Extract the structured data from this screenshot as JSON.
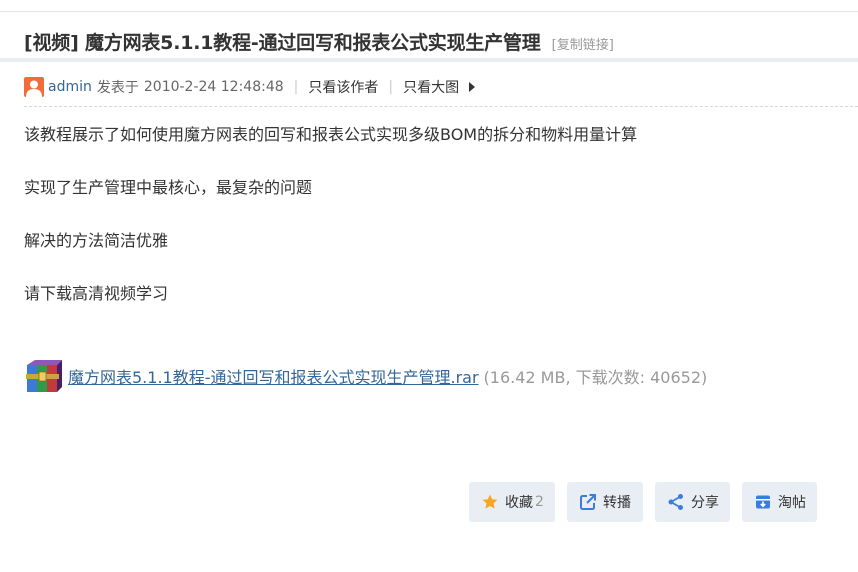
{
  "post": {
    "title": "[视频] 魔方网表5.1.1教程-通过回写和报表公式实现生产管理",
    "copy_link": "[复制链接]",
    "author": "admin",
    "posted_prefix": "发表于",
    "posted_time": "2010-2-24 12:48:48",
    "sep": "|",
    "only_author": "只看该作者",
    "large_image": "只看大图"
  },
  "content": {
    "lines": [
      "该教程展示了如何使用魔方网表的回写和报表公式实现多级BOM的拆分和物料用量计算",
      "实现了生产管理中最核心，最复杂的问题",
      "解决的方法简洁优雅",
      "请下载高清视频学习"
    ]
  },
  "attachment": {
    "filename": "魔方网表5.1.1教程-通过回写和报表公式实现生产管理.rar",
    "info": "(16.42 MB, 下载次数: 40652)"
  },
  "actions": {
    "favorite_label": "收藏",
    "favorite_count": "2",
    "repost_label": "转播",
    "share_label": "分享",
    "taotie_label": "淘帖"
  },
  "colors": {
    "link": "#336699",
    "avatar": "#f26b3a",
    "action_bg": "#e8eef3",
    "icon_blue": "#3b7ddc",
    "star": "#f5a623"
  }
}
